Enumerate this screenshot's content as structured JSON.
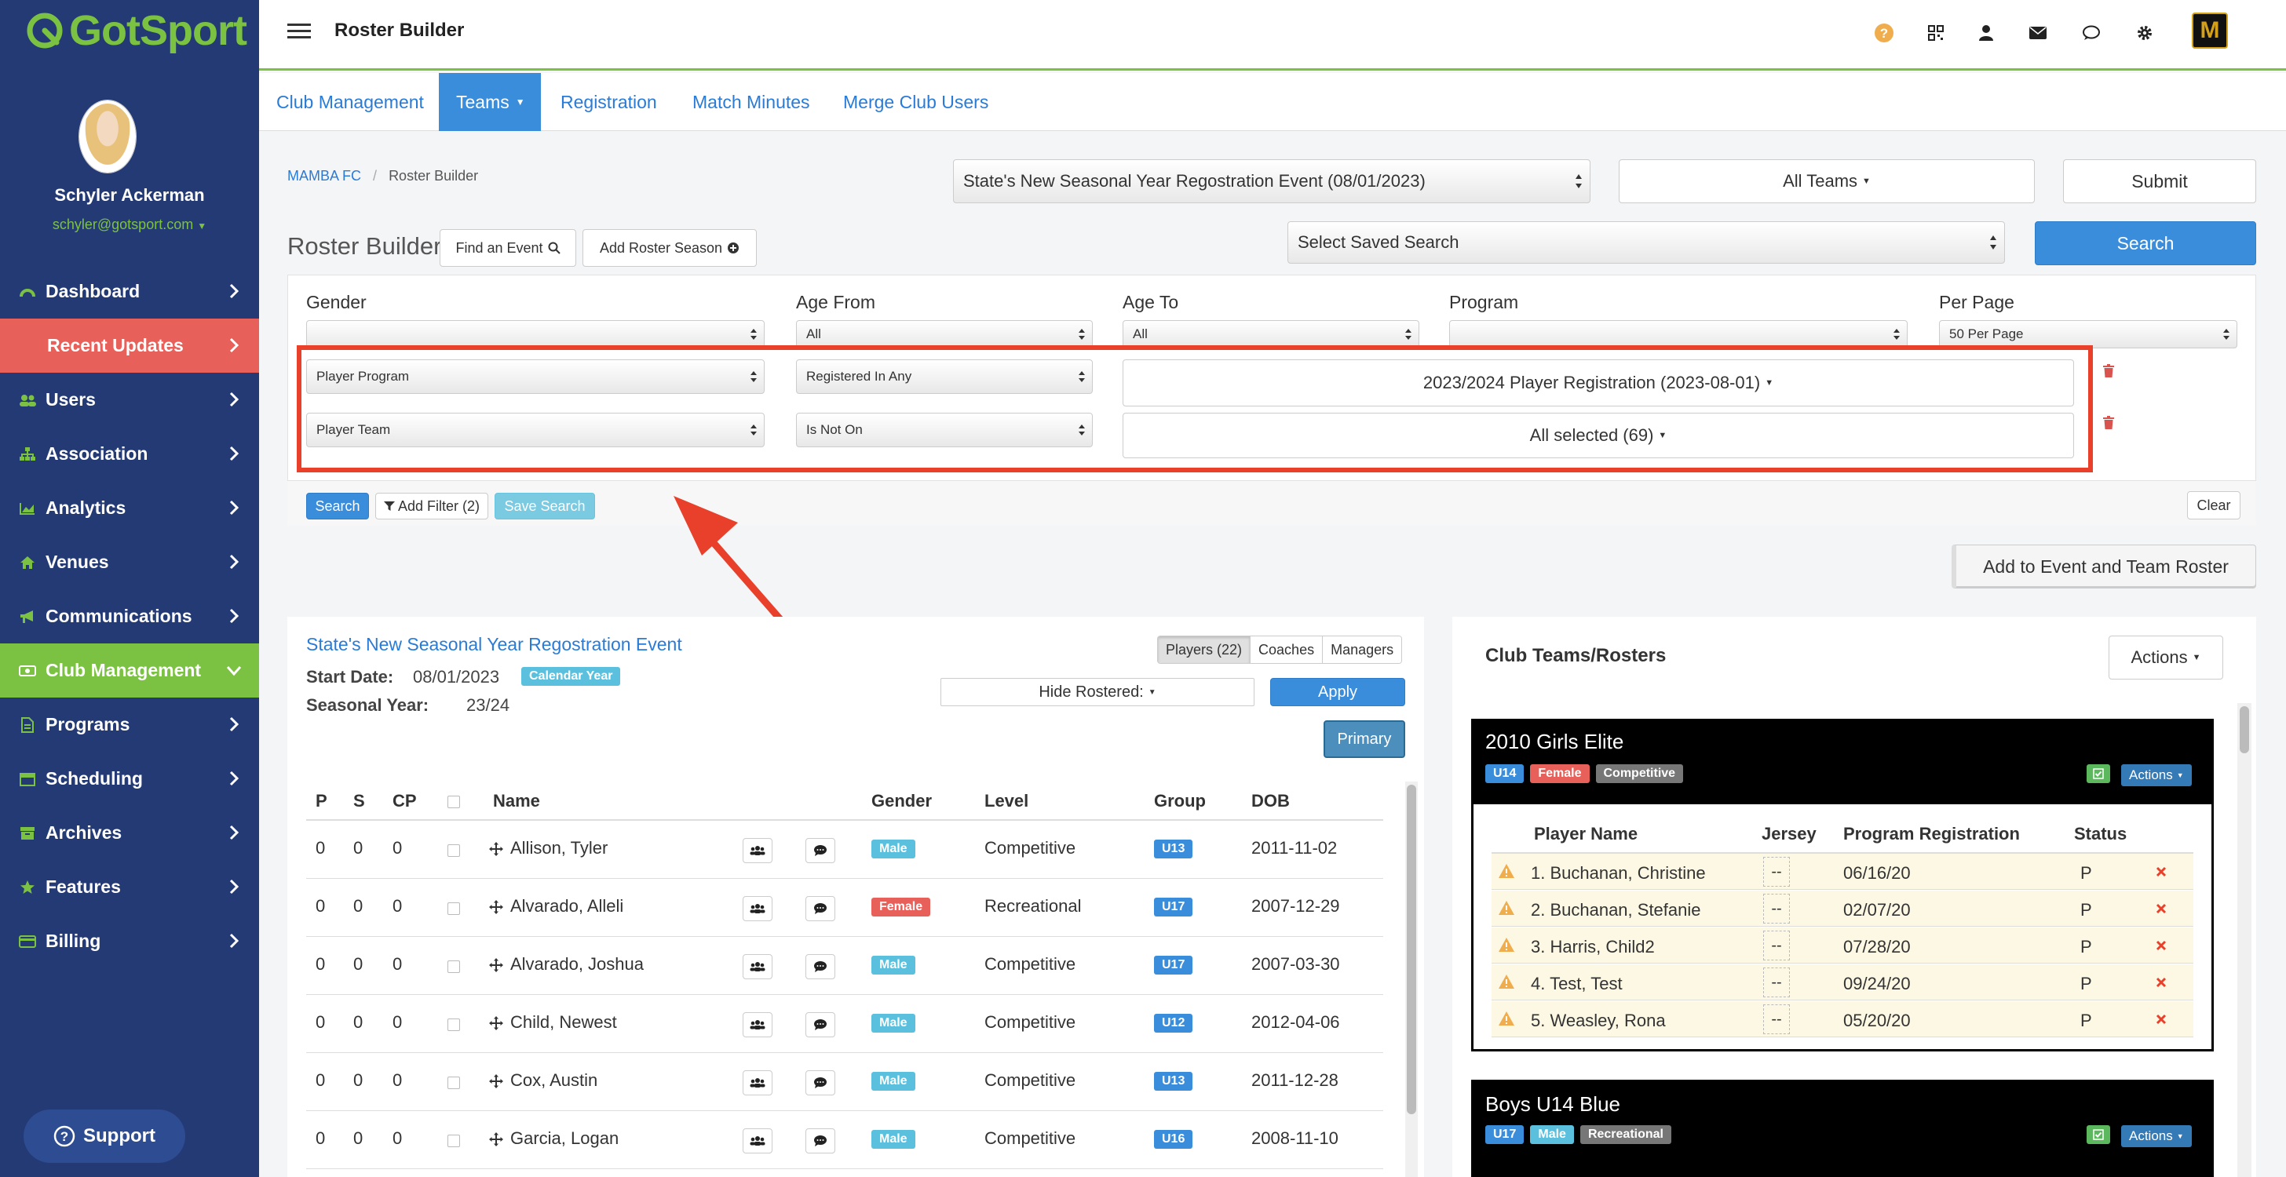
{
  "sidebar": {
    "logo": "GotSport",
    "user_name": "Schyler Ackerman",
    "user_email": "schyler@gotsport.com",
    "items": [
      {
        "label": "Dashboard",
        "icon": "dashboard-icon"
      },
      {
        "label": "Recent Updates",
        "icon": "none"
      },
      {
        "label": "Users",
        "icon": "users-icon"
      },
      {
        "label": "Association",
        "icon": "sitemap-icon"
      },
      {
        "label": "Analytics",
        "icon": "chart-icon"
      },
      {
        "label": "Venues",
        "icon": "home-icon"
      },
      {
        "label": "Communications",
        "icon": "bullhorn-icon"
      },
      {
        "label": "Club Management",
        "icon": "club-icon"
      },
      {
        "label": "Programs",
        "icon": "file-icon"
      },
      {
        "label": "Scheduling",
        "icon": "calendar-icon"
      },
      {
        "label": "Archives",
        "icon": "archive-icon"
      },
      {
        "label": "Features",
        "icon": "star-icon"
      },
      {
        "label": "Billing",
        "icon": "credit-card-icon"
      }
    ],
    "support": "Support"
  },
  "header": {
    "title": "Roster Builder"
  },
  "tabs": [
    "Club Management",
    "Teams",
    "Registration",
    "Match Minutes",
    "Merge Club Users"
  ],
  "breadcrumb": {
    "club": "MAMBA FC",
    "page": "Roster Builder"
  },
  "top_controls": {
    "event_select": "State's New Seasonal Year Regostration Event (08/01/2023)",
    "teams_dropdown": "All Teams",
    "submit": "Submit",
    "saved_search": "Select Saved Search",
    "search": "Search"
  },
  "roster_builder": {
    "title": "Roster Builder",
    "find_event": "Find an Event",
    "add_season": "Add Roster Season"
  },
  "filters": {
    "labels": {
      "gender": "Gender",
      "age_from": "Age From",
      "age_to": "Age To",
      "program": "Program",
      "per_page": "Per Page"
    },
    "values": {
      "gender": "",
      "age_from": "All",
      "age_to": "All",
      "program": "",
      "per_page": "50 Per Page"
    },
    "rows": [
      {
        "field": "Player Program",
        "op": "Registered In Any",
        "value": "2023/2024 Player Registration (2023-08-01)"
      },
      {
        "field": "Player Team",
        "op": "Is Not On",
        "value": "All selected (69)"
      }
    ],
    "search": "Search",
    "add_filter": "Add Filter (2)",
    "save_search": "Save Search",
    "clear": "Clear"
  },
  "add_to_event": "Add to Event and Team Roster",
  "event_panel": {
    "title": "State's New Seasonal Year Regostration Event",
    "start_label": "Start Date:",
    "start_value": "08/01/2023",
    "calendar_badge": "Calendar Year",
    "season_label": "Seasonal Year:",
    "season_value": "23/24",
    "toggle": [
      "Players (22)",
      "Coaches",
      "Managers"
    ],
    "hide_rostered": "Hide Rostered:",
    "apply": "Apply",
    "primary": "Primary",
    "columns": [
      "P",
      "S",
      "CP",
      "",
      "Name",
      "",
      "",
      "Gender",
      "Level",
      "Group",
      "DOB"
    ],
    "players": [
      {
        "p": "0",
        "s": "0",
        "cp": "0",
        "name": "Allison, Tyler",
        "gender": "Male",
        "level": "Competitive",
        "group": "U13",
        "dob": "2011-11-02"
      },
      {
        "p": "0",
        "s": "0",
        "cp": "0",
        "name": "Alvarado, Alleli",
        "gender": "Female",
        "level": "Recreational",
        "group": "U17",
        "dob": "2007-12-29"
      },
      {
        "p": "0",
        "s": "0",
        "cp": "0",
        "name": "Alvarado, Joshua",
        "gender": "Male",
        "level": "Competitive",
        "group": "U17",
        "dob": "2007-03-30"
      },
      {
        "p": "0",
        "s": "0",
        "cp": "0",
        "name": "Child, Newest",
        "gender": "Male",
        "level": "Competitive",
        "group": "U12",
        "dob": "2012-04-06"
      },
      {
        "p": "0",
        "s": "0",
        "cp": "0",
        "name": "Cox, Austin",
        "gender": "Male",
        "level": "Competitive",
        "group": "U13",
        "dob": "2011-12-28"
      },
      {
        "p": "0",
        "s": "0",
        "cp": "0",
        "name": "Garcia, Logan",
        "gender": "Male",
        "level": "Competitive",
        "group": "U16",
        "dob": "2008-11-10"
      }
    ]
  },
  "teams_panel": {
    "title": "Club Teams/Rosters",
    "actions": "Actions",
    "teams": [
      {
        "name": "2010 Girls Elite",
        "badges": [
          "U14",
          "Female",
          "Competitive"
        ],
        "actions": "Actions",
        "columns": [
          "Player Name",
          "Jersey",
          "Program Registration",
          "Status"
        ],
        "players": [
          {
            "name": "1. Buchanan, Christine",
            "jersey": "--",
            "reg": "06/16/20",
            "status": "P"
          },
          {
            "name": "2. Buchanan, Stefanie",
            "jersey": "--",
            "reg": "02/07/20",
            "status": "P"
          },
          {
            "name": "3. Harris, Child2",
            "jersey": "--",
            "reg": "07/28/20",
            "status": "P"
          },
          {
            "name": "4. Test, Test",
            "jersey": "--",
            "reg": "09/24/20",
            "status": "P"
          },
          {
            "name": "5. Weasley, Rona",
            "jersey": "--",
            "reg": "05/20/20",
            "status": "P"
          }
        ]
      },
      {
        "name": "Boys U14 Blue",
        "badges": [
          "U17",
          "Male",
          "Recreational"
        ],
        "actions": "Actions"
      }
    ]
  },
  "colors": {
    "sidebar": "#243a75",
    "accent_green": "#7cc242",
    "accent_blue": "#3a8ddb",
    "highlight_red": "#e8402a"
  }
}
